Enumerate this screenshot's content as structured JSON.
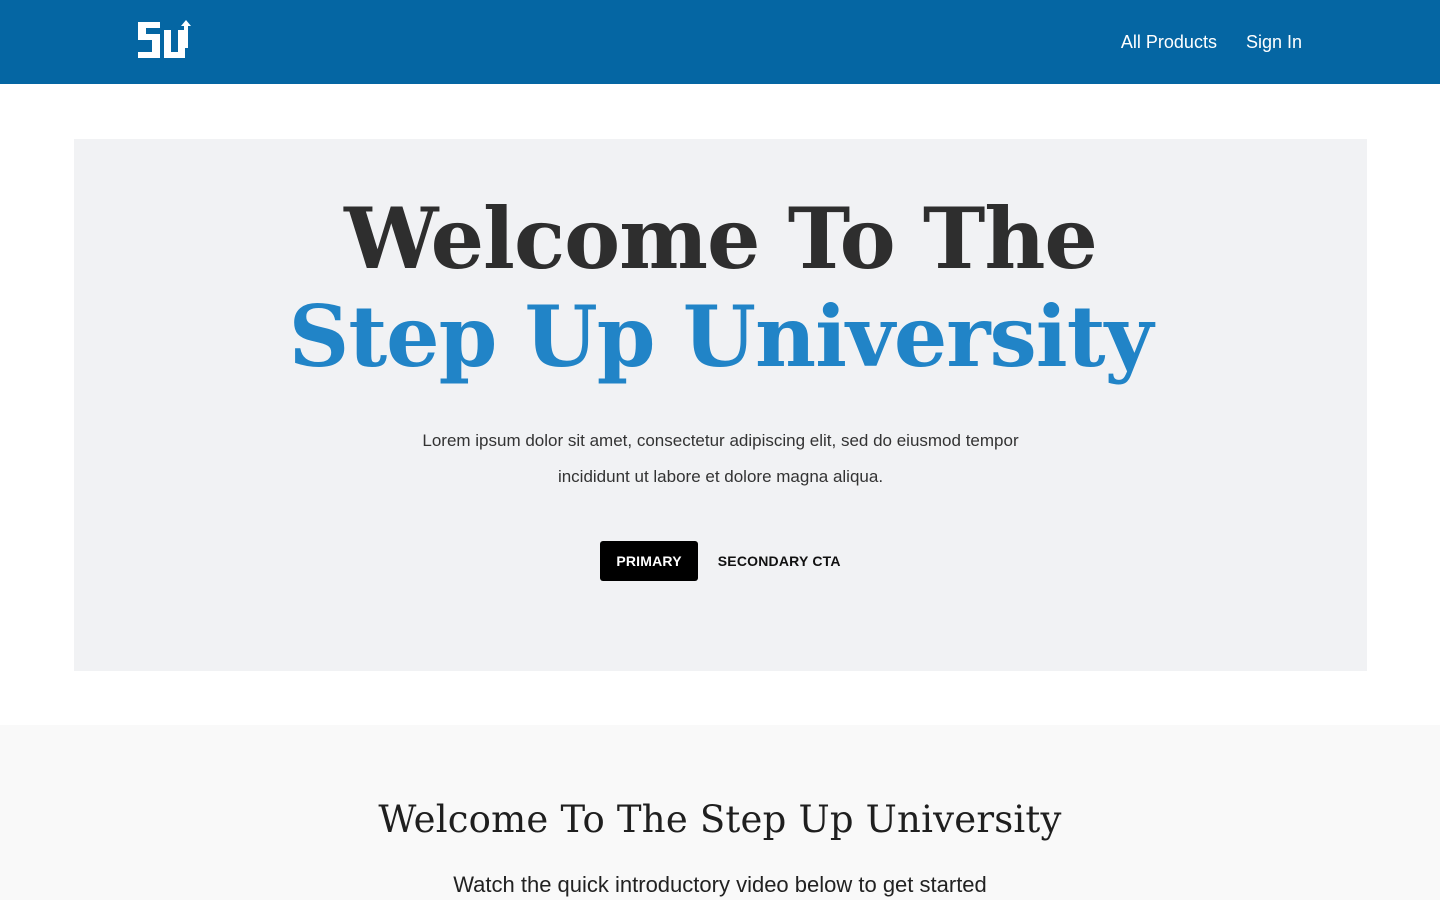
{
  "header": {
    "logo_icon": "step-up-logo-icon",
    "nav": {
      "all_products": "All Products",
      "sign_in": "Sign In"
    },
    "background_color": "#0566a3"
  },
  "hero": {
    "title_line1": "Welcome To The",
    "title_line2": "Step Up University",
    "description_line1": "Lorem ipsum dolor sit amet, consectetur adipiscing elit, sed do eiusmod tempor",
    "description_line2": "incididunt ut labore et dolore magna aliqua.",
    "primary_button": "PRIMARY",
    "secondary_button": "SECONDARY CTA",
    "accent_color": "#2184c7"
  },
  "intro_section": {
    "title": "Welcome To The Step Up University",
    "subtitle": "Watch the quick introductory video below to get started"
  }
}
